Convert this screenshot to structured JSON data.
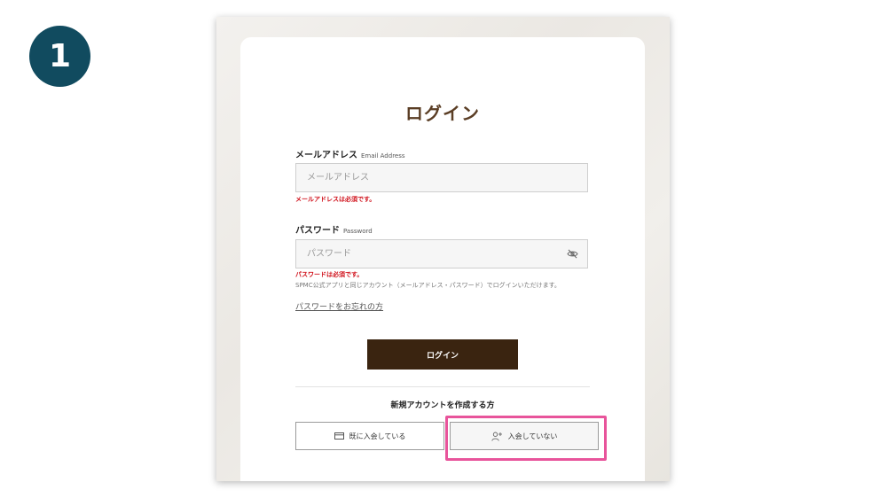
{
  "step": {
    "number": "1"
  },
  "login": {
    "title": "ログイン",
    "email": {
      "label": "メールアドレス",
      "sublabel": "Email Address",
      "placeholder": "メールアドレス",
      "value": "",
      "error": "メールアドレスは必須です。"
    },
    "password": {
      "label": "パスワード",
      "sublabel": "Password",
      "placeholder": "パスワード",
      "value": "",
      "error": "パスワードは必須です。",
      "toggle_icon": "eye-slash-icon"
    },
    "note": "SPMC公式アプリと同じアカウント（メールアドレス・パスワード）でログインいただけます。",
    "forgot_link": "パスワードをお忘れの方",
    "login_button": "ログイン"
  },
  "new_account": {
    "heading": "新規アカウントを作成する方",
    "member_button": {
      "label": "既に入会している",
      "icon": "card-icon"
    },
    "nonmember_button": {
      "label": "入会していない",
      "icon": "add-user-icon"
    }
  },
  "colors": {
    "step_badge": "#114b5f",
    "title": "#5a3d24",
    "login_button": "#3a2410",
    "error": "#d0111b",
    "highlight": "#e8549b"
  }
}
